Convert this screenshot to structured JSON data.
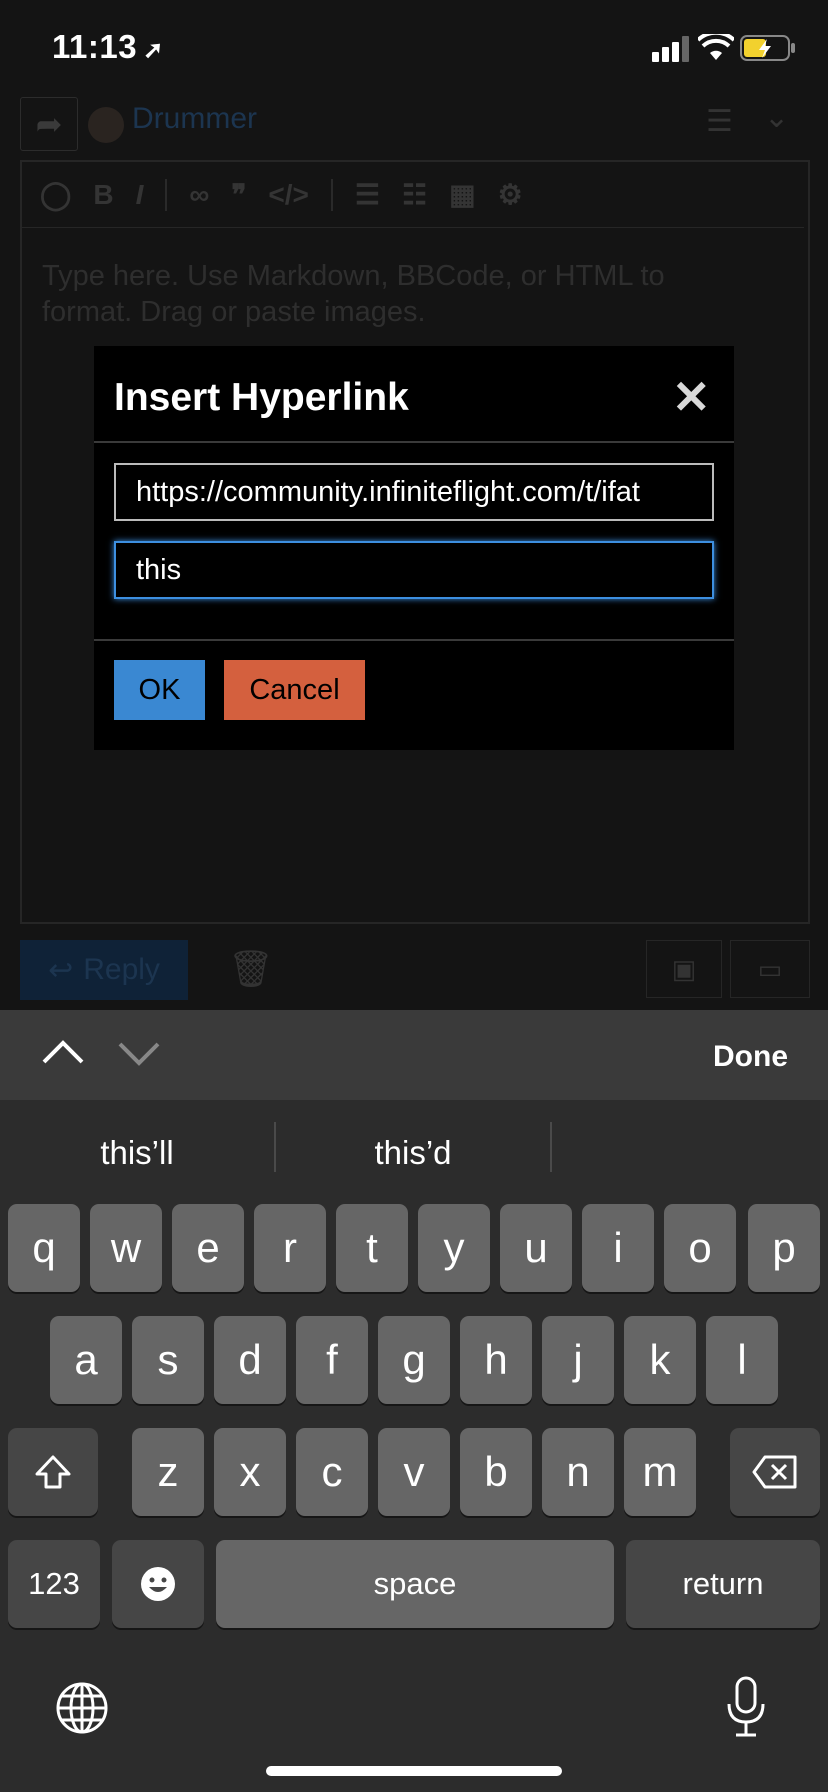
{
  "status_bar": {
    "time": "11:13"
  },
  "background": {
    "username": "Drummer",
    "placeholder": "Type here. Use Markdown, BBCode, or HTML to format. Drag or paste images.",
    "reply_label": "Reply"
  },
  "dialog": {
    "title": "Insert Hyperlink",
    "url_value": "https://community.infiniteflight.com/t/ifat",
    "text_value": "this",
    "ok_label": "OK",
    "cancel_label": "Cancel"
  },
  "accessory": {
    "done_label": "Done"
  },
  "keyboard": {
    "suggestions": [
      "this’ll",
      "this’d",
      ""
    ],
    "row1": [
      "q",
      "w",
      "e",
      "r",
      "t",
      "y",
      "u",
      "i",
      "o",
      "p"
    ],
    "row2": [
      "a",
      "s",
      "d",
      "f",
      "g",
      "h",
      "j",
      "k",
      "l"
    ],
    "row3": [
      "z",
      "x",
      "c",
      "v",
      "b",
      "n",
      "m"
    ],
    "numbers_label": "123",
    "space_label": "space",
    "return_label": "return"
  },
  "colors": {
    "ok": "#3a88d2",
    "cancel": "#d4603e",
    "focus": "#3d8fe0"
  }
}
